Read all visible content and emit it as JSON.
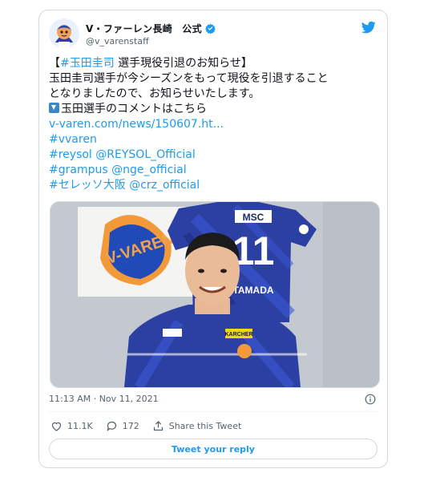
{
  "tweet": {
    "display_name": "V・ファーレン長崎　公式",
    "handle": "@v_varenstaff",
    "lines": [
      {
        "hashtag": "#玉田圭司",
        "prefix": "【",
        "suffix": " 選手現役引退のお知らせ】"
      },
      {
        "text": "玉田圭司選手が今シーズンをもって現役を引退すること"
      },
      {
        "text": "となりましたので、お知らせいたします。"
      },
      {
        "text": "玉田選手のコメントはこちら"
      },
      {
        "link": "v-varen.com/news/150607.ht..."
      },
      {
        "link": "#vvaren"
      },
      {
        "hashtag": "#reysol",
        "mention": "@REYSOL_Official"
      },
      {
        "hashtag": "#grampus",
        "mention": "@nge_official"
      },
      {
        "hashtag": "#セレッソ大阪",
        "mention": "@crz_official"
      }
    ],
    "media": {
      "banner_text": "V-VAREN",
      "jersey_sponsor": "MSC",
      "jersey_number": "11",
      "jersey_name": "TAMADA",
      "shirt_sponsor": "KARCHER"
    },
    "timestamp": "11:13 AM · Nov 11, 2021",
    "actions": {
      "likes": "11.1K",
      "replies": "172",
      "share_label": "Share this Tweet"
    },
    "reply_label": "Tweet your reply"
  },
  "colors": {
    "accent": "#1d9bf0",
    "text": "#0f1419",
    "muted": "#536471",
    "border": "#cfd9de",
    "kit_blue": "#2c3fa3"
  },
  "icons": [
    "twitter-bird-icon",
    "verified-badge-icon",
    "info-icon",
    "heart-icon",
    "reply-bubble-icon",
    "share-icon",
    "down-arrow-emoji-icon"
  ]
}
